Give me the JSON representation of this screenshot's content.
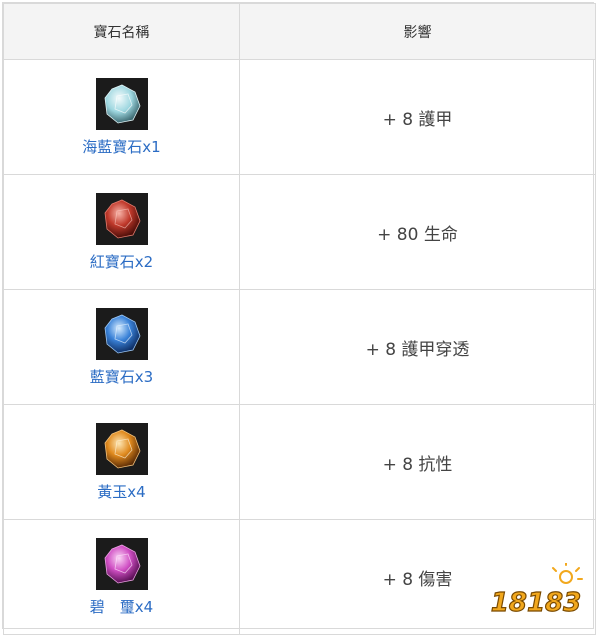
{
  "table": {
    "header_name": "寶石名稱",
    "header_effect": "影響",
    "rows": [
      {
        "label": "海藍寶石x1",
        "effect": "+ 8 護甲",
        "icon": "aquamarine-gem-icon",
        "color": "#9ed7e0"
      },
      {
        "label": "紅寶石x2",
        "effect": "+ 80 生命",
        "icon": "ruby-gem-icon",
        "color": "#c0392b"
      },
      {
        "label": "藍寶石x3",
        "effect": "+ 8 護甲穿透",
        "icon": "sapphire-gem-icon",
        "color": "#3a82d8"
      },
      {
        "label": "黃玉x4",
        "effect": "+ 8 抗性",
        "icon": "topaz-gem-icon",
        "color": "#e08a1e"
      },
      {
        "label": "碧　璽x4",
        "effect": "+ 8 傷害",
        "icon": "tourmaline-gem-icon",
        "color": "#d04fc4"
      }
    ]
  },
  "watermark": {
    "text": "18183",
    "accent_color": "#f2a81d"
  }
}
